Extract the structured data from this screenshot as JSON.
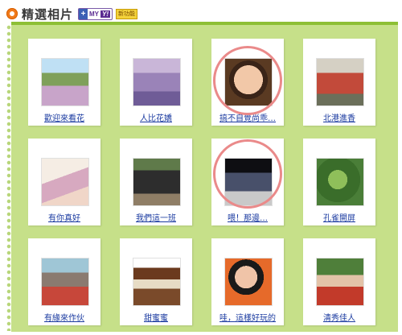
{
  "header": {
    "title": "精選相片",
    "myyahoo_badge": "+ MY",
    "myyahoo_y": "Y!",
    "new_badge": "新功能"
  },
  "photos": [
    {
      "caption": "歡迎來看花",
      "icon": "photo-girls-flowers",
      "highlighted": false
    },
    {
      "caption": "人比花嬌",
      "icon": "photo-woman-lavender",
      "highlighted": false
    },
    {
      "caption": "搞不自覺尚乖…",
      "icon": "photo-child-eating",
      "highlighted": true
    },
    {
      "caption": "北港進香",
      "icon": "photo-parade",
      "highlighted": false
    },
    {
      "caption": "有你真好",
      "icon": "photo-mother-baby",
      "highlighted": false
    },
    {
      "caption": "我們這一班",
      "icon": "photo-class-group",
      "highlighted": false
    },
    {
      "caption": "喂！那邊…",
      "icon": "photo-cat",
      "highlighted": true
    },
    {
      "caption": "孔雀開屏",
      "icon": "photo-green-fruit",
      "highlighted": false
    },
    {
      "caption": "有緣來作伙",
      "icon": "photo-group-outdoor",
      "highlighted": false
    },
    {
      "caption": "甜蜜蜜",
      "icon": "photo-cake",
      "highlighted": false
    },
    {
      "caption": "哇，這樣好玩的",
      "icon": "photo-child-playing",
      "highlighted": false
    },
    {
      "caption": "清秀佳人",
      "icon": "photo-girl-traditional",
      "highlighted": false
    }
  ],
  "colors": {
    "panel_bg": "#c6e089",
    "panel_border": "#8dbf35",
    "caption_link": "#1a3aa0",
    "highlight_ring": "#ea8a8a",
    "header_icon": "#f07a1a"
  }
}
